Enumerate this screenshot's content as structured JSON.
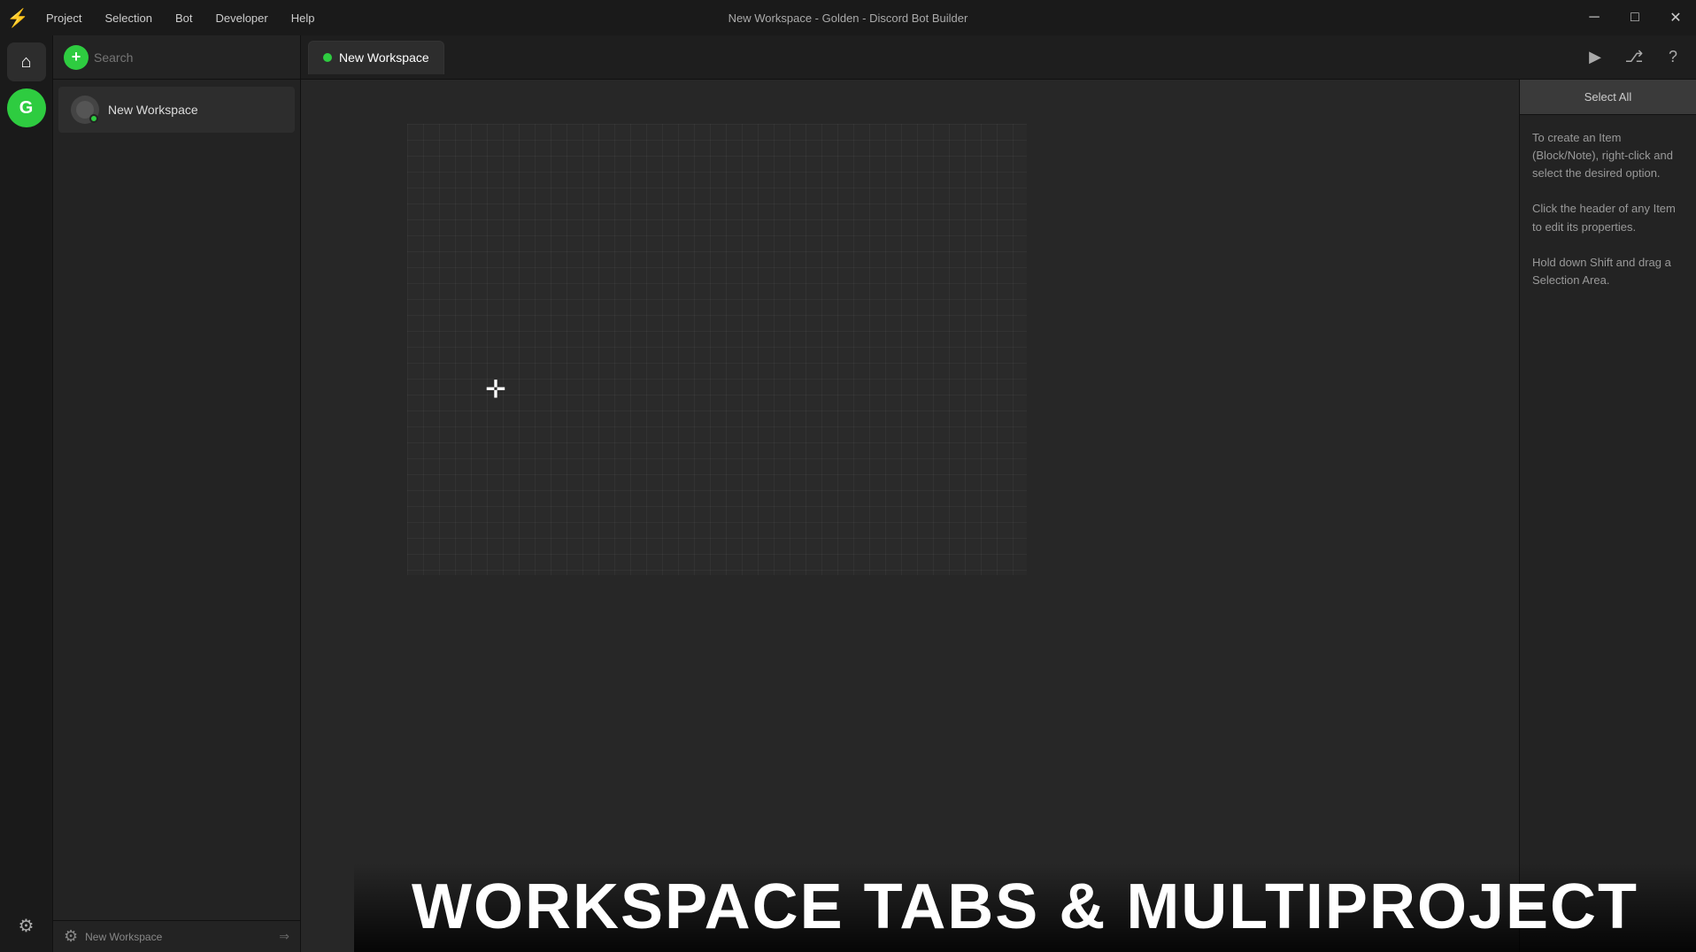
{
  "titlebar": {
    "app_title": "New Workspace - Golden - Discord Bot Builder",
    "menu_items": [
      "Project",
      "Selection",
      "Bot",
      "Developer",
      "Help"
    ],
    "minimize_label": "─",
    "maximize_label": "□",
    "close_label": "✕"
  },
  "icon_sidebar": {
    "home_label": "⌂",
    "user_initial": "G"
  },
  "workspace_panel": {
    "search_placeholder": "Search",
    "add_button_label": "+",
    "workspaces": [
      {
        "name": "New Workspace",
        "active": true
      }
    ],
    "footer_label": "New Workspace",
    "settings_icon": "⚙",
    "export_icon": "⇒"
  },
  "tabs": [
    {
      "label": "New Workspace",
      "active": true
    }
  ],
  "tab_actions": {
    "play_label": "▶",
    "tree_label": "⎇",
    "help_label": "?"
  },
  "right_panel": {
    "select_all_label": "Select All",
    "info_lines": [
      "To create an Item (Block/Note), right-click and select the desired option.",
      "Click the header of any Item to edit its properties.",
      "Hold down Shift and drag a Selection Area."
    ]
  },
  "canvas": {
    "cursor_symbol": "✛"
  },
  "overlay": {
    "title": "WORKSPACE TABS & MULTIPROJECT"
  }
}
